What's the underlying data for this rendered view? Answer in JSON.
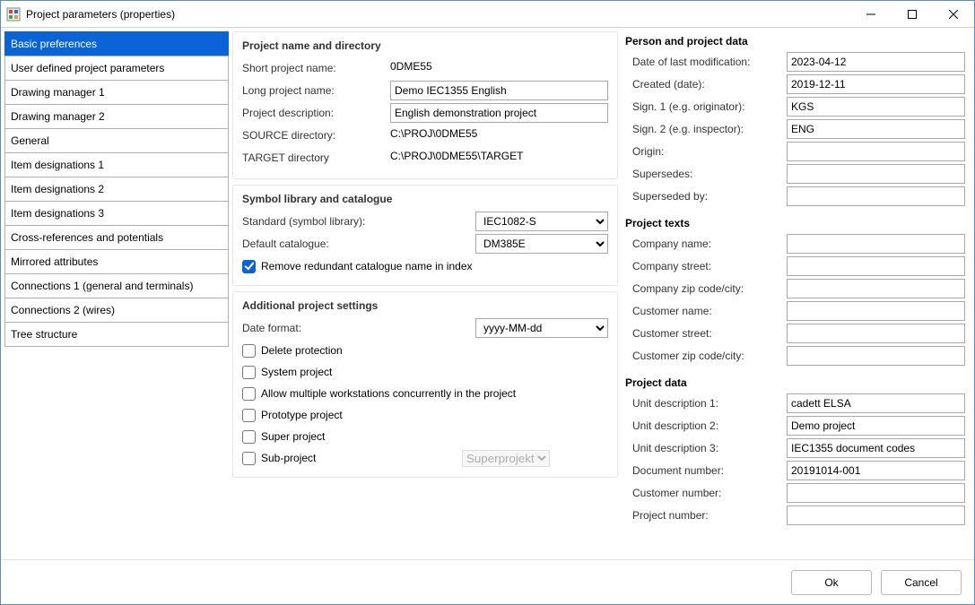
{
  "window": {
    "title": "Project parameters (properties)"
  },
  "sidebar": {
    "items": [
      "Basic preferences",
      "User defined project parameters",
      "Drawing manager 1",
      "Drawing manager 2",
      "General",
      "Item designations 1",
      "Item designations 2",
      "Item designations 3",
      "Cross-references and potentials",
      "Mirrored attributes",
      "Connections 1 (general and terminals)",
      "Connections 2 (wires)",
      "Tree structure"
    ],
    "selected_index": 0
  },
  "sections": {
    "name_dir": {
      "title": "Project name and directory",
      "short_name_lbl": "Short project name:",
      "short_name": "0DME55",
      "long_name_lbl": "Long project name:",
      "long_name": "Demo IEC1355 English",
      "desc_lbl": "Project description:",
      "desc": "English demonstration project",
      "source_lbl": "SOURCE directory:",
      "source": "C:\\PROJ\\0DME55",
      "target_lbl": "TARGET directory",
      "target": "C:\\PROJ\\0DME55\\TARGET"
    },
    "symlib": {
      "title": "Symbol library and catalogue",
      "standard_lbl": "Standard (symbol library):",
      "standard": "IEC1082-S",
      "catalogue_lbl": "Default catalogue:",
      "catalogue": "DM385E",
      "remove_redundant_lbl": "Remove redundant catalogue name in index"
    },
    "additional": {
      "title": "Additional project settings",
      "dateformat_lbl": "Date format:",
      "dateformat": "yyyy-MM-dd",
      "delete_protection_lbl": "Delete protection",
      "system_project_lbl": "System project",
      "allow_multiple_lbl": "Allow multiple workstations concurrently in the project",
      "prototype_lbl": "Prototype project",
      "super_lbl": "Super project",
      "sub_lbl": "Sub-project",
      "super_select": "Superprojekt"
    },
    "person": {
      "title": "Person and project data",
      "mod_lbl": "Date of last modification:",
      "mod": "2023-04-12",
      "created_lbl": "Created (date):",
      "created": "2019-12-11",
      "sign1_lbl": "Sign. 1 (e.g. originator):",
      "sign1": "KGS",
      "sign2_lbl": "Sign. 2 (e.g. inspector):",
      "sign2": "ENG",
      "origin_lbl": "Origin:",
      "origin": "",
      "supersedes_lbl": "Supersedes:",
      "supersedes": "",
      "superseded_by_lbl": "Superseded by:",
      "superseded_by": ""
    },
    "texts": {
      "title": "Project texts",
      "company_name_lbl": "Company name:",
      "company_name": "",
      "company_street_lbl": "Company street:",
      "company_street": "",
      "company_zip_lbl": "Company zip code/city:",
      "company_zip": "",
      "customer_name_lbl": "Customer name:",
      "customer_name": "",
      "customer_street_lbl": "Customer street:",
      "customer_street": "",
      "customer_zip_lbl": "Customer zip code/city:",
      "customer_zip": ""
    },
    "pdata": {
      "title": "Project data",
      "unit1_lbl": "Unit description 1:",
      "unit1": "cadett ELSA",
      "unit2_lbl": "Unit description 2:",
      "unit2": "Demo project",
      "unit3_lbl": "Unit description 3:",
      "unit3": "IEC1355 document codes",
      "docnum_lbl": "Document number:",
      "docnum": "20191014-001",
      "custnum_lbl": "Customer number:",
      "custnum": "",
      "projnum_lbl": "Project number:",
      "projnum": ""
    }
  },
  "footer": {
    "ok": "Ok",
    "cancel": "Cancel"
  }
}
